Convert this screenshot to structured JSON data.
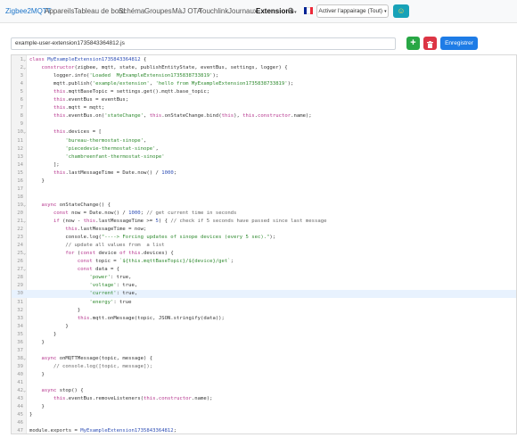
{
  "navbar": {
    "brand": "Zigbee2MQTT",
    "items": [
      {
        "label": "Appareils"
      },
      {
        "label": "Tableau de bord"
      },
      {
        "label": "Schéma"
      },
      {
        "label": "Groupes"
      },
      {
        "label": "MàJ OTA"
      },
      {
        "label": "Touchlink"
      },
      {
        "label": "Journaux"
      },
      {
        "label": "Extensions"
      }
    ],
    "active_item": "Extensions",
    "settings_icon": "gear-icon",
    "language_icon": "french-flag-icon",
    "permit_join_label": "Activer l'appairage (Tout)",
    "permit_join_icon": "smiley-icon"
  },
  "toolbar": {
    "filename": "example-user-extension1735843364812.js",
    "add_icon": "plus-icon",
    "delete_icon": "trash-icon",
    "save_label": "Enregistrer"
  },
  "colors": {
    "brand": "#1a73c8",
    "add": "#28a745",
    "delete": "#dc3545",
    "save": "#1e7ce6",
    "permit_icon": "#17a2b8",
    "active_line": "#e8f2fe"
  },
  "editor": {
    "active_line": 30,
    "lines": [
      "class MyExampleExtension1735843364812 {",
      "    constructor(zigbee, mqtt, state, publishEntityState, eventBus, settings, logger) {",
      "        logger.info('Loaded  MyExampleExtension1735838733819');",
      "        mqtt.publish('example/extension', 'hello from MyExampleExtension1735838733819');",
      "        this.mqttBaseTopic = settings.get().mqtt.base_topic;",
      "        this.eventBus = eventBus;",
      "        this.mqtt = mqtt;",
      "        this.eventBus.on('stateChange', this.onStateChange.bind(this), this.constructor.name);",
      "",
      "        this.devices = [",
      "            'bureau-thermostat-sinope',",
      "            'piecedevie-thermostat-sinope',",
      "            'chambreenfant-thermostat-sinope'",
      "        ];",
      "        this.lastMessageTime = Date.now() / 1000;",
      "    }",
      "",
      "",
      "    async onStateChange() {",
      "        const now = Date.now() / 1000; // get current time in seconds",
      "        if (now - this.lastMessageTime >= 5) { // check if 5 seconds have passed since last message",
      "            this.lastMessageTime = now;",
      "            console.log(\"----> Forcing updates of sinope devices (every 5 sec).\");",
      "            // update all values from  a list",
      "            for (const device of this.devices) {",
      "                const topic = `${this.mqttBaseTopic}/${device}/get`;",
      "                const data = {",
      "                    'power': true,",
      "                    'voltage': true,",
      "                    'current': true,",
      "                    'energy': true",
      "                }",
      "                this.mqtt.onMessage(topic, JSON.stringify(data));",
      "            }",
      "        }",
      "    }",
      "",
      "    async onMQTTMessage(topic, message) {",
      "        // console.log([topic, message]);",
      "    }",
      "",
      "    async stop() {",
      "        this.eventBus.removeListeners(this.constructor.name);",
      "    }",
      "}",
      "",
      "module.exports = MyExampleExtension1735843364812;",
      ""
    ]
  }
}
